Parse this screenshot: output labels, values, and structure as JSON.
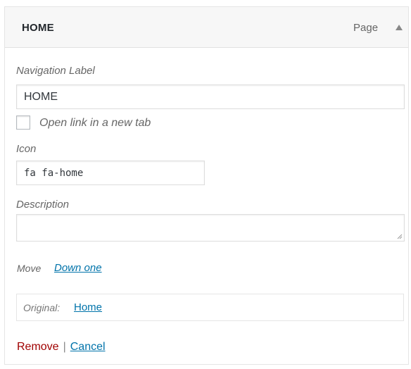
{
  "menu_item": {
    "title": "HOME",
    "type": "Page",
    "toggle_icon": "triangle-up-icon"
  },
  "fields": {
    "navigation_label": {
      "label": "Navigation Label",
      "value": "HOME"
    },
    "open_new_tab": {
      "label": "Open link in a new tab",
      "checked": false
    },
    "icon": {
      "label": "Icon",
      "value": "fa fa-home"
    },
    "description": {
      "label": "Description",
      "value": ""
    }
  },
  "move": {
    "label": "Move",
    "link": "Down one"
  },
  "original": {
    "label": "Original:",
    "link": "Home"
  },
  "actions": {
    "remove": "Remove",
    "separator": "|",
    "cancel": "Cancel"
  },
  "colors": {
    "link": "#0073aa",
    "remove": "#a00000",
    "header_bg": "#f7f7f7"
  }
}
